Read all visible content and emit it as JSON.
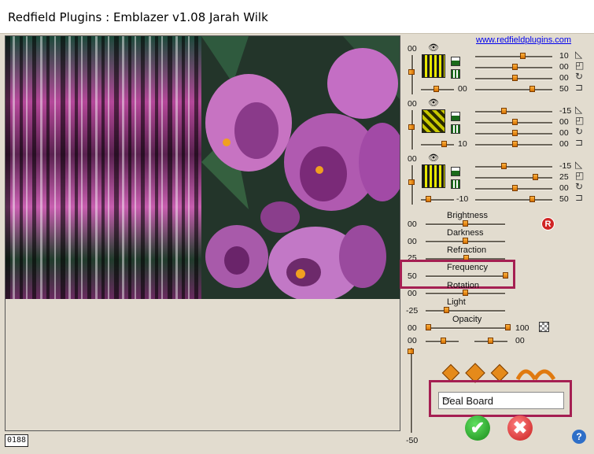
{
  "window": {
    "title": "Redfield Plugins : Emblazer v1.08   Jarah Wilk"
  },
  "link": "www.redfieldplugins.com",
  "counter": "0188",
  "layers": [
    {
      "eye": "00",
      "values": [
        "10",
        "00",
        "00"
      ],
      "bottom_left": "00",
      "bottom_right": "50"
    },
    {
      "eye": "00",
      "values": [
        "-15",
        "00",
        "00"
      ],
      "bottom_left": "10",
      "bottom_right": "00"
    },
    {
      "eye": "00",
      "values": [
        "-15",
        "25",
        "00"
      ],
      "bottom_left": "-10",
      "bottom_right": "50"
    }
  ],
  "params": [
    {
      "label": "Brightness",
      "value": "00"
    },
    {
      "label": "Darkness",
      "value": "00"
    },
    {
      "label": "Refraction",
      "value": "25"
    },
    {
      "label": "Frequency",
      "value": "50"
    },
    {
      "label": "Rotation",
      "value": "00"
    },
    {
      "label": "Light",
      "value": "-25"
    },
    {
      "label": "Opacity",
      "value": "00",
      "right_value": "100"
    }
  ],
  "bottom_row": {
    "left": "00",
    "right": "00"
  },
  "vertical_slider": {
    "top": "00",
    "bottom": "-50"
  },
  "preset": {
    "selected": "Deal Board"
  },
  "reset_label": "R",
  "help_label": "?",
  "colors": {
    "highlight": "#a51f52",
    "ok": "#1a8a1a",
    "cancel": "#c81e1e",
    "knob": "#e58a1a"
  }
}
